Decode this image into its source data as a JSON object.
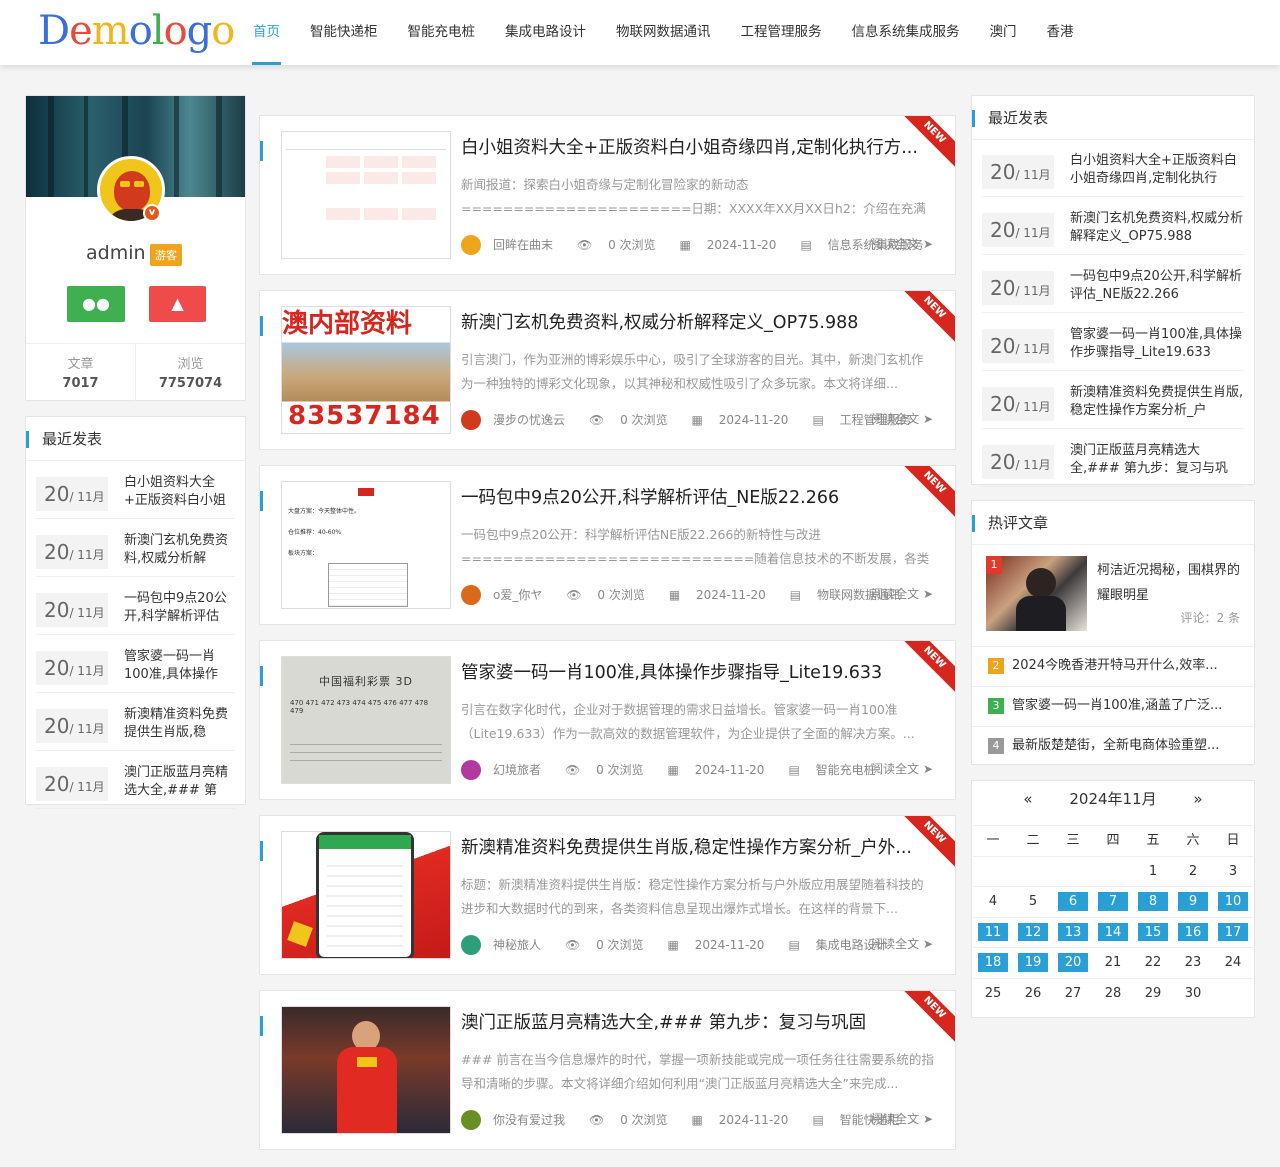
{
  "header": {
    "logo": "Demologo",
    "nav": [
      "首页",
      "智能快递柜",
      "智能充电桩",
      "集成电路设计",
      "物联网数据通讯",
      "工程管理服务",
      "信息系统集成服务",
      "澳门",
      "香港"
    ]
  },
  "profile": {
    "username": "admin",
    "role_badge": "游客",
    "stats": [
      {
        "label": "文章",
        "value": "7017"
      },
      {
        "label": "浏览",
        "value": "7757074"
      }
    ]
  },
  "left_recent": {
    "title": "最近发表",
    "items": [
      {
        "day": "20",
        "month": "/ 11月",
        "title": "白小姐资料大全+正版资料白小姐"
      },
      {
        "day": "20",
        "month": "/ 11月",
        "title": "新澳门玄机免费资料,权威分析解"
      },
      {
        "day": "20",
        "month": "/ 11月",
        "title": "一码包中9点20公开,科学解析评估"
      },
      {
        "day": "20",
        "month": "/ 11月",
        "title": "管家婆一码一肖100准,具体操作"
      },
      {
        "day": "20",
        "month": "/ 11月",
        "title": "新澳精准资料免费提供生肖版,稳"
      },
      {
        "day": "20",
        "month": "/ 11月",
        "title": "澳门正版蓝月亮精选大全,### 第"
      }
    ]
  },
  "articles": [
    {
      "title": "白小姐资料大全+正版资料白小姐奇缘四肖,定制化执行方...",
      "desc": "新闻报道：探索白小姐奇缘与定制化冒险家的新动态======================日期：XXXX年XX月XX日h2：介绍在充满奇幻和神秘的现代文化背景下，我们一直...",
      "author": "回眸在曲末",
      "views": "0 次浏览",
      "date": "2024-11-20",
      "category": "信息系统集成服务",
      "more": "阅读全文",
      "tag": "NEW"
    },
    {
      "title": "新澳门玄机免费资料,权威分析解释定义_OP75.988",
      "desc": "引言澳门，作为亚洲的博彩娱乐中心，吸引了全球游客的目光。其中，新澳门玄机作为一种独特的博彩文化现象，以其神秘和权威性吸引了众多玩家。本文将详细...",
      "author": "漫步の忧逸云",
      "views": "0 次浏览",
      "date": "2024-11-20",
      "category": "工程管理服务",
      "more": "阅读全文",
      "tag": "NEW"
    },
    {
      "title": "一码包中9点20公开,科学解析评估_NE版22.266",
      "desc": "一码包中9点20公开：科学解析评估NE版22.266的新特性与改进============================随着信息技术的不断发展，各类软件和版本...",
      "author": "o爱_你ヤ",
      "views": "0 次浏览",
      "date": "2024-11-20",
      "category": "物联网数据通讯",
      "more": "阅读全文",
      "tag": "NEW"
    },
    {
      "title": "管家婆一码一肖100准,具体操作步骤指导_Lite19.633",
      "desc": "引言在数字化时代，企业对于数据管理的需求日益增长。管家婆一码一肖100准（Lite19.633）作为一款高效的数据管理软件，为企业提供了全面的解决方案。...",
      "author": "幻境旅者",
      "views": "0 次浏览",
      "date": "2024-11-20",
      "category": "智能充电桩",
      "more": "阅读全文",
      "tag": "NEW"
    },
    {
      "title": "新澳精准资料免费提供生肖版,稳定性操作方案分析_户外...",
      "desc": "标题：新澳精准资料提供生肖版：稳定性操作方案分析与户外版应用展望随着科技的进步和大数据时代的到来，各类资料信息呈现出爆炸式增长。在这样的背景下...",
      "author": "神秘旅人",
      "views": "0 次浏览",
      "date": "2024-11-20",
      "category": "集成电路设计",
      "more": "阅读全文",
      "tag": "NEW"
    },
    {
      "title": "澳门正版蓝月亮精选大全,### 第九步：复习与巩固",
      "desc": "### 前言在当今信息爆炸的时代，掌握一项新技能或完成一项任务往往需要系统的指导和清晰的步骤。本文将详细介绍如何利用“澳门正版蓝月亮精选大全”来完成...",
      "author": "你没有爱过我",
      "views": "0 次浏览",
      "date": "2024-11-20",
      "category": "智能快递柜",
      "more": "阅读全文",
      "tag": "NEW"
    }
  ],
  "thumb_text": {
    "thumb2_banner": "澳内部资料",
    "thumb2_number": "83537184",
    "thumb4_title": "中国福利彩票 3D",
    "thumb4_nums": "470 471 472 473 474 475 476 477 478 479"
  },
  "right_recent": {
    "title": "最近发表",
    "items": [
      {
        "day": "20",
        "month": "/ 11月",
        "title": "白小姐资料大全+正版资料白小姐奇缘四肖,定制化执行"
      },
      {
        "day": "20",
        "month": "/ 11月",
        "title": "新澳门玄机免费资料,权威分析解释定义_OP75.988"
      },
      {
        "day": "20",
        "month": "/ 11月",
        "title": "一码包中9点20公开,科学解析评估_NE版22.266"
      },
      {
        "day": "20",
        "month": "/ 11月",
        "title": "管家婆一码一肖100准,具体操作步骤指导_Lite19.633"
      },
      {
        "day": "20",
        "month": "/ 11月",
        "title": "新澳精准资料免费提供生肖版,稳定性操作方案分析_户"
      },
      {
        "day": "20",
        "month": "/ 11月",
        "title": "澳门正版蓝月亮精选大全,### 第九步：复习与巩"
      }
    ]
  },
  "hot": {
    "title": "热评文章",
    "top": {
      "num": "1",
      "title": "柯洁近况揭秘，围棋界的耀眼明星",
      "comments": "评论：2 条"
    },
    "items": [
      {
        "num": "2",
        "title": "2024今晚香港开特马开什么,效率...",
        "color": "#f0a31c"
      },
      {
        "num": "3",
        "title": "管家婆一码一肖100准,涵盖了广泛...",
        "color": "#3fb04f"
      },
      {
        "num": "4",
        "title": "最新版楚楚街，全新电商体验重塑...",
        "color": "#999999"
      }
    ]
  },
  "calendar": {
    "prev": "«",
    "month": "2024年11月",
    "next": "»",
    "weekdays": [
      "一",
      "二",
      "三",
      "四",
      "五",
      "六",
      "日"
    ],
    "weeks": [
      [
        "",
        "",
        "",
        "",
        "1",
        "2",
        "3"
      ],
      [
        "4",
        "5",
        "6",
        "7",
        "8",
        "9",
        "10"
      ],
      [
        "11",
        "12",
        "13",
        "14",
        "15",
        "16",
        "17"
      ],
      [
        "18",
        "19",
        "20",
        "21",
        "22",
        "23",
        "24"
      ],
      [
        "25",
        "26",
        "27",
        "28",
        "29",
        "30",
        ""
      ]
    ],
    "highlighted": [
      "6",
      "7",
      "8",
      "9",
      "10",
      "11",
      "12",
      "13",
      "14",
      "15",
      "16",
      "17",
      "18",
      "19",
      "20"
    ]
  }
}
